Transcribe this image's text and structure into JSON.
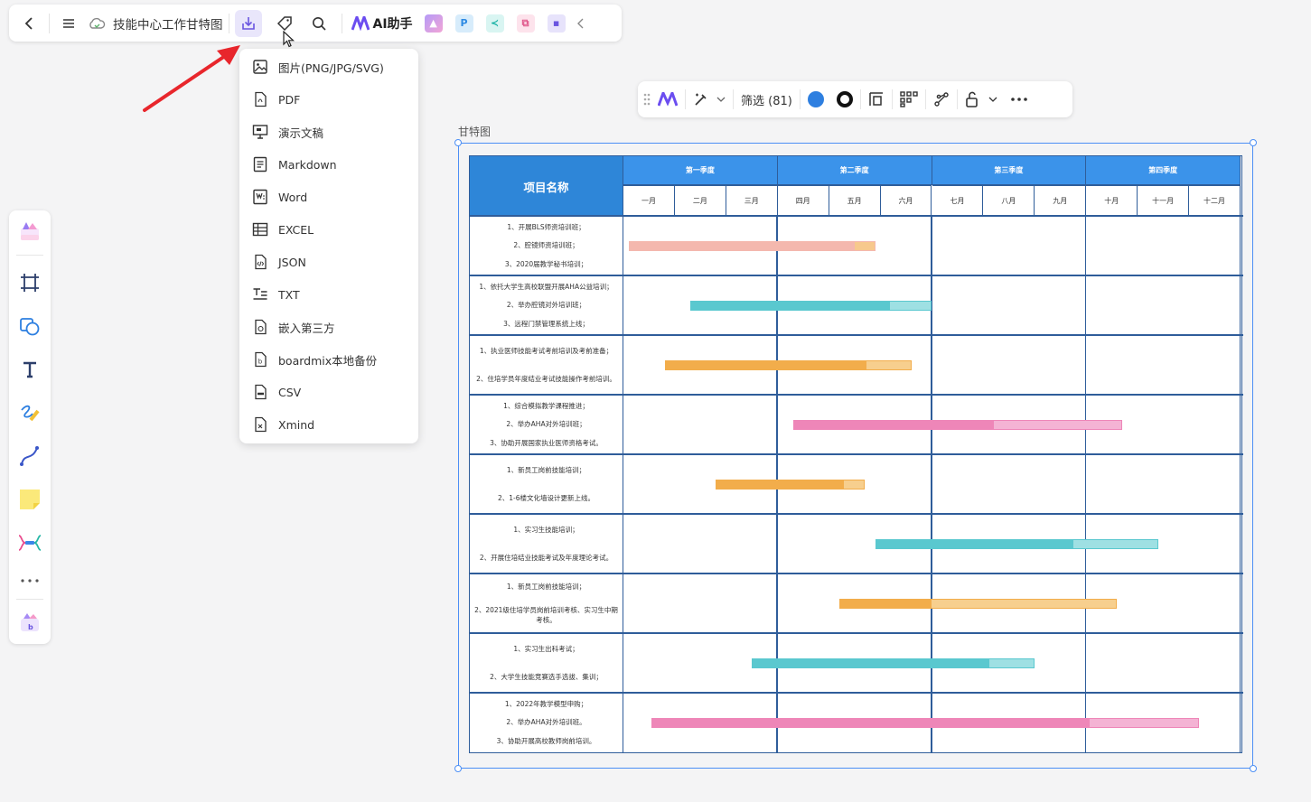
{
  "topbar": {
    "title": "技能中心工作甘特图",
    "ai_label": "AI助手",
    "app_p_label": "P"
  },
  "export_menu": {
    "items": [
      {
        "label": "图片(PNG/JPG/SVG)",
        "icon": "image-icon"
      },
      {
        "label": "PDF",
        "icon": "pdf-icon"
      },
      {
        "label": "演示文稿",
        "icon": "presentation-icon"
      },
      {
        "label": "Markdown",
        "icon": "markdown-icon"
      },
      {
        "label": "Word",
        "icon": "word-icon"
      },
      {
        "label": "EXCEL",
        "icon": "excel-icon"
      },
      {
        "label": "JSON",
        "icon": "json-icon"
      },
      {
        "label": "TXT",
        "icon": "txt-icon"
      },
      {
        "label": "嵌入第三方",
        "icon": "embed-icon"
      },
      {
        "label": "boardmix本地备份",
        "icon": "backup-icon"
      },
      {
        "label": "CSV",
        "icon": "csv-icon"
      },
      {
        "label": "Xmind",
        "icon": "xmind-icon"
      }
    ]
  },
  "floatbar": {
    "filter_label": "筛选 (81)",
    "fill_color": "#2e7fe0",
    "stroke_color": "#111111"
  },
  "frame": {
    "label": "甘特图"
  },
  "gantt": {
    "name_header": "项目名称",
    "quarters": [
      "第一季度",
      "第二季度",
      "第三季度",
      "第四季度"
    ],
    "months": [
      "一月",
      "二月",
      "三月",
      "四月",
      "五月",
      "六月",
      "七月",
      "八月",
      "九月",
      "十月",
      "十一月",
      "十二月"
    ],
    "rows": [
      {
        "tasks": [
          "1、开展BLS师资培训班；",
          "2、腔镜师资培训班；",
          "3、2020届教学秘书培训；"
        ],
        "start": 0.1,
        "end": 4.9,
        "progress": 0.92,
        "color": "#f4b8ae",
        "rest_color": "#f7c98d"
      },
      {
        "tasks": [
          "1、依托大学生高校联盟开展AHA公益培训；",
          "2、举办腔镜对外培训班；",
          "3、远程门禁管理系统上线；"
        ],
        "start": 1.3,
        "end": 6.0,
        "progress": 0.83,
        "color": "#5ac8cf",
        "rest_color": "#9ee0e3"
      },
      {
        "tasks": [
          "1、执业医师技能考试考前培训及考前准备；",
          "2、住培学员年度结业考试技能操作考前培训。"
        ],
        "start": 0.8,
        "end": 5.6,
        "progress": 0.82,
        "color": "#f2ad4b",
        "rest_color": "#f7cf8e"
      },
      {
        "tasks": [
          "1、综合模拟教学课程推进；",
          "2、举办AHA对外培训班；",
          "3、协助开展国家执业医师资格考试。"
        ],
        "start": 3.3,
        "end": 9.7,
        "progress": 0.61,
        "color": "#ee86b8",
        "rest_color": "#f4b3d4"
      },
      {
        "tasks": [
          "1、新员工岗前技能培训；",
          "2、1-6楼文化墙设计更新上线。"
        ],
        "start": 1.8,
        "end": 4.7,
        "progress": 0.86,
        "color": "#f2ad4b",
        "rest_color": "#f7cf8e"
      },
      {
        "tasks": [
          "1、实习生技能培训；",
          "2、开展住培结业技能考试及年度理论考试。"
        ],
        "start": 4.9,
        "end": 10.4,
        "progress": 0.7,
        "color": "#5ac8cf",
        "rest_color": "#9ee0e3"
      },
      {
        "tasks": [
          "1、新员工岗前技能培训；",
          "2、2021级住培学员岗前培训考核、实习生中期考核。"
        ],
        "start": 4.2,
        "end": 9.6,
        "progress": 0.33,
        "color": "#f2ad4b",
        "rest_color": "#f7cf8e"
      },
      {
        "tasks": [
          "1、实习生出科考试；",
          "2、大学生技能竞赛选手选拔、集训；"
        ],
        "start": 2.5,
        "end": 8.0,
        "progress": 0.84,
        "color": "#5ac8cf",
        "rest_color": "#9ee0e3"
      },
      {
        "tasks": [
          "1、2022年教学模型申购；",
          "2、举办AHA对外培训班。",
          "3、协助开展高校教师岗前培训。"
        ],
        "start": 0.55,
        "end": 11.2,
        "progress": 0.8,
        "color": "#ee86b8",
        "rest_color": "#f4b3d4"
      }
    ]
  }
}
